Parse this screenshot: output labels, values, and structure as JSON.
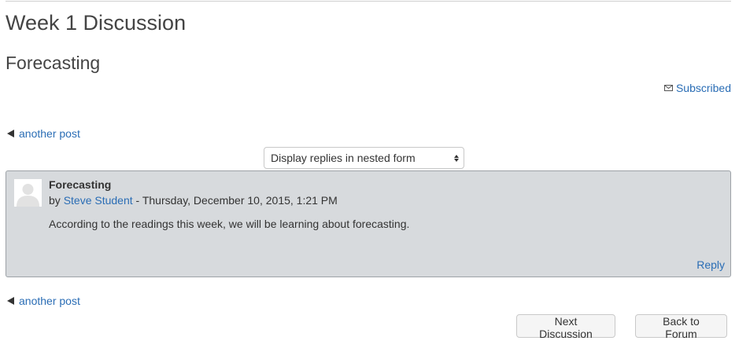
{
  "page": {
    "title": "Week 1 Discussion",
    "discussion_name": "Forecasting"
  },
  "subscription": {
    "label": "Subscribed",
    "icon": "mail-icon"
  },
  "navigation": {
    "prev_label": "another post",
    "prev_icon": "triangle-left-icon"
  },
  "display_mode": {
    "selected": "Display replies in nested form"
  },
  "post": {
    "subject": "Forecasting",
    "by_prefix": "by",
    "author": "Steve Student",
    "date_suffix": " - Thursday, December 10, 2015, 1:21 PM",
    "message": "According to the readings this week, we will be learning about forecasting.",
    "reply_label": "Reply"
  },
  "buttons": {
    "next": "Next Discussion",
    "back": "Back to Forum"
  },
  "colors": {
    "link": "#2a6db5",
    "post_background": "#d7dadd",
    "post_border": "#9da2a7"
  }
}
